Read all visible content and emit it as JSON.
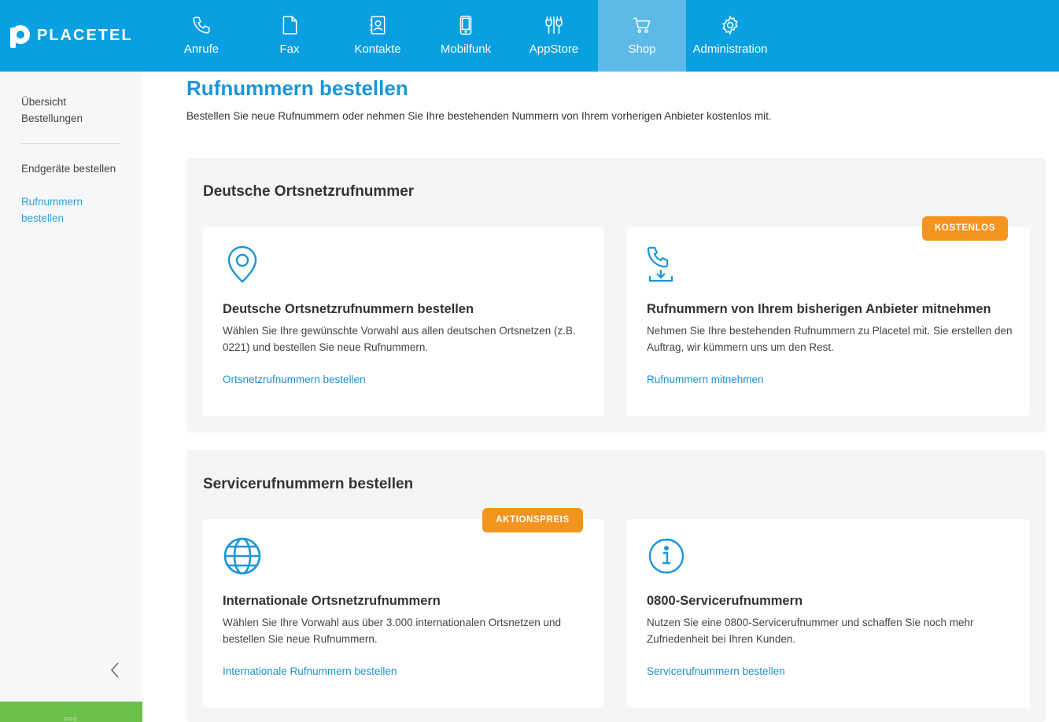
{
  "brand": {
    "name": "PLACETEL"
  },
  "nav": {
    "items": [
      {
        "label": "Anrufe",
        "icon": "phone-icon"
      },
      {
        "label": "Fax",
        "icon": "fax-icon"
      },
      {
        "label": "Kontakte",
        "icon": "contacts-icon"
      },
      {
        "label": "Mobilfunk",
        "icon": "mobile-icon"
      },
      {
        "label": "AppStore",
        "icon": "plug-icon"
      },
      {
        "label": "Shop",
        "icon": "cart-icon",
        "active": true
      },
      {
        "label": "Administration",
        "icon": "gear-icon"
      }
    ]
  },
  "sidebar": {
    "items": [
      {
        "label": "Übersicht Bestellungen"
      },
      {
        "label": "Endgeräte bestellen"
      },
      {
        "label": "Rufnummern bestellen",
        "active": true
      }
    ],
    "bottom_label": "○○○"
  },
  "main": {
    "title": "Rufnummern bestellen",
    "subtitle": "Bestellen Sie neue Rufnummern oder nehmen Sie Ihre bestehenden Nummern von Ihrem vorherigen Anbieter kostenlos mit.",
    "sections": [
      {
        "title": "Deutsche Ortsnetzrufnummer",
        "cards": [
          {
            "icon": "location-pin-icon",
            "title": "Deutsche Ortsnetzrufnummern bestellen",
            "description": "Wählen Sie Ihre gewünschte Vorwahl aus allen deutschen Ortsnetzen (z.B. 0221) und bestellen Sie neue Rufnummern.",
            "link": "Ortsnetzrufnummern bestellen"
          },
          {
            "icon": "phone-download-icon",
            "badge": "KOSTENLOS",
            "title": "Rufnummern von Ihrem bisherigen Anbieter mitnehmen",
            "description": "Nehmen Sie Ihre bestehenden Rufnummern zu Placetel mit. Sie erstellen den Auftrag, wir kümmern uns um den Rest.",
            "link": "Rufnummern mitnehmen"
          }
        ]
      },
      {
        "title": "Servicerufnummern bestellen",
        "cards": [
          {
            "icon": "globe-icon",
            "badge": "AKTIONSPREIS",
            "title": "Internationale Ortsnetzrufnummern",
            "description": "Wählen Sie Ihre Vorwahl aus über 3.000 internationalen Ortsnetzen und bestellen Sie neue Rufnummern.",
            "link": "Internationale Rufnummern bestellen"
          },
          {
            "icon": "info-icon",
            "title": "0800-Servicerufnummern",
            "description": "Nutzen Sie eine 0800-Servicerufnummer und schaffen Sie noch mehr Zufriedenheit bei Ihren Kunden.",
            "link": "Servicerufnummern bestellen"
          }
        ]
      }
    ]
  },
  "colors": {
    "primary": "#0a9fe0",
    "nav_active": "#5db9e8",
    "badge": "#f5931f",
    "link": "#1f8fd0",
    "accent_green": "#6cc04a"
  }
}
